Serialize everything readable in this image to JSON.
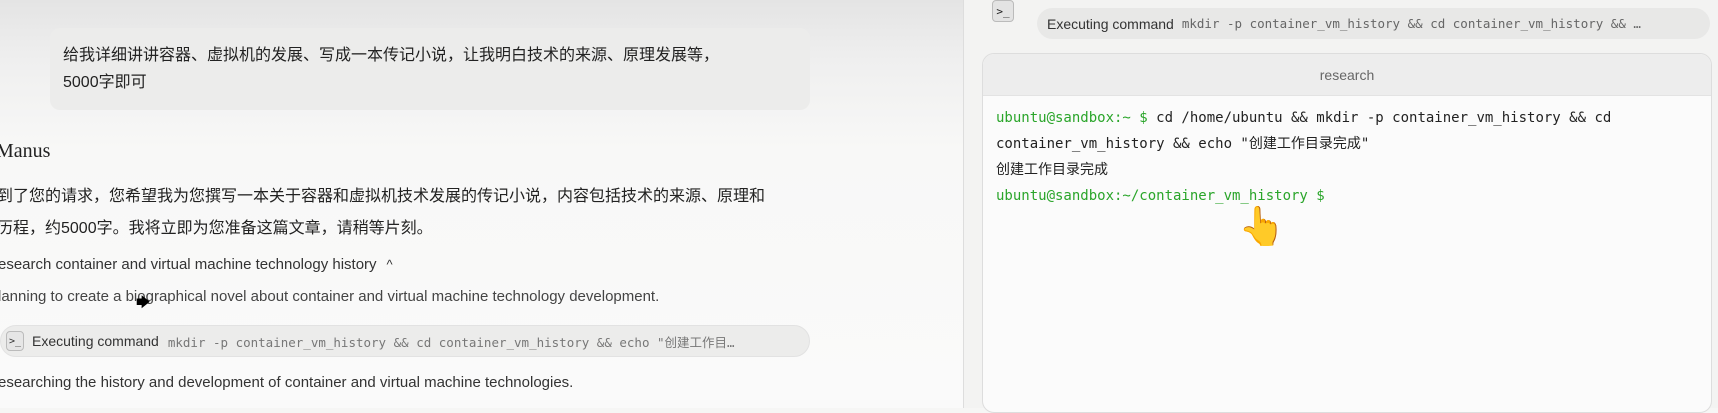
{
  "chat": {
    "user_message_line1": "给我详细讲讲容器、虚拟机的发展、写成一本传记小说，让我明白技术的来源、原理发展等，",
    "user_message_line2": "5000字即可",
    "agent_name": "Manus",
    "reply_line1": "到了您的请求，您希望我为您撰写一本关于容器和虚拟机技术发展的传记小说，内容包括技术的来源、原理和",
    "reply_line2": "历程，约5000字。我将立即为您准备这篇文章，请稍等片刻。",
    "step_title": "esearch container and virtual machine technology history",
    "step_chevron": "^",
    "planning_text": "lanning to create a biographical novel about container and virtual machine technology development.",
    "command_label": "Executing command",
    "command_text": "mkdir -p container_vm_history && cd container_vm_history && echo \"创建工作目…",
    "researching_text": "esearching the history and development of container and virtual machine technologies."
  },
  "panel": {
    "command_label": "Executing command",
    "command_text": "mkdir -p container_vm_history && cd container_vm_history && …",
    "terminal_title": "research",
    "lines": {
      "prompt1": "ubuntu@sandbox:~ $",
      "cmd1": " cd /home/ubuntu && mkdir -p container_vm_history && cd",
      "cmd1_cont": "container_vm_history && echo \"创建工作目录完成\"",
      "output1": "创建工作目录完成",
      "prompt2": "ubuntu@sandbox:~/container_vm_history $"
    }
  },
  "icons": {
    "terminal": "terminal-icon",
    "chevron": "chevron-up-icon",
    "hand": "hand-pointer-cursor"
  },
  "colors": {
    "prompt_green": "#2aa52a"
  }
}
